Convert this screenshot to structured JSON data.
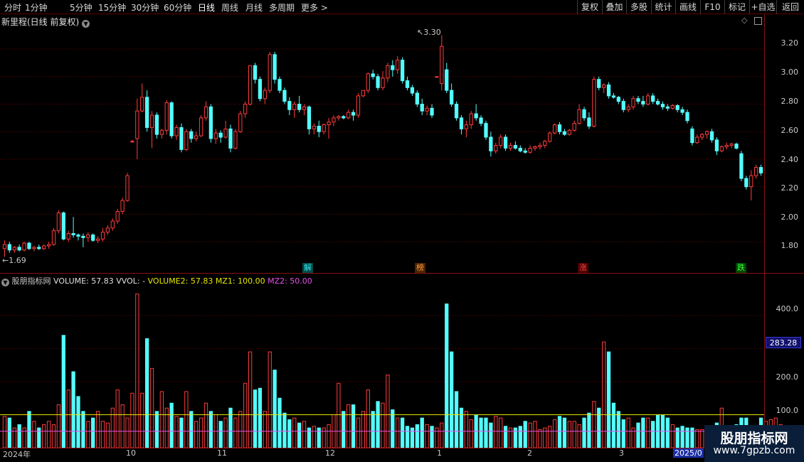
{
  "toolbar": {
    "periods": [
      "分时",
      "1分钟",
      "5分钟",
      "15分钟",
      "30分钟",
      "60分钟",
      "日线",
      "周线",
      "月线",
      "多周期",
      "更多 >"
    ],
    "active_period": "日线",
    "right_buttons": [
      "复权",
      "叠加",
      "多股",
      "统计",
      "画线",
      "F10",
      "标记",
      "+自选",
      "返回"
    ]
  },
  "price_panel": {
    "title": "新里程(日线 前复权)",
    "max_label": "3.30",
    "min_label": "1.69",
    "y_ticks": [
      "3.20",
      "3.00",
      "2.80",
      "2.60",
      "2.40",
      "2.20",
      "2.00",
      "1.80"
    ],
    "events": [
      {
        "label": "解",
        "color": "#35e8e8",
        "bg": "#004848"
      },
      {
        "label": "榜",
        "color": "#ff9944",
        "bg": "#4a2400"
      },
      {
        "label": "涨",
        "color": "#ff4040",
        "bg": "#480000"
      },
      {
        "label": "跌",
        "color": "#40ff40",
        "bg": "#004400"
      }
    ]
  },
  "volume_panel": {
    "indicator_name": "股朋指标网",
    "volume": "VOLUME: 57.83",
    "vvol": "VVOL: -",
    "volume2": "VOLUME2: 57.83",
    "mz1": "MZ1: 100.00",
    "mz2": "MZ2: 50.00",
    "y_ticks": [
      "400.0",
      "200.0",
      "100.0"
    ],
    "current_label": "283.28"
  },
  "x_axis": [
    "2024年",
    "10",
    "11",
    "12",
    "1",
    "2",
    "3",
    "2025/0"
  ],
  "watermark": {
    "line1": "股朋指标网",
    "line2": "www.7gpzb.com"
  },
  "colors": {
    "up": "#ff3c3c",
    "down": "#54ffff",
    "mz1": "#e8e800",
    "mz2": "#e84fe8",
    "grid": "#7a0000"
  },
  "chart_data": [
    {
      "type": "candlestick",
      "title": "新里程(日线 前复权)",
      "ylim": [
        1.62,
        3.35
      ],
      "annotations": {
        "high": 3.3,
        "low": 1.69
      },
      "ohlc": [
        [
          1.75,
          1.81,
          1.69,
          1.78
        ],
        [
          1.78,
          1.8,
          1.72,
          1.74
        ],
        [
          1.74,
          1.77,
          1.72,
          1.76
        ],
        [
          1.76,
          1.78,
          1.73,
          1.74
        ],
        [
          1.74,
          1.8,
          1.73,
          1.79
        ],
        [
          1.79,
          1.8,
          1.74,
          1.75
        ],
        [
          1.75,
          1.77,
          1.73,
          1.76
        ],
        [
          1.76,
          1.78,
          1.74,
          1.75
        ],
        [
          1.75,
          1.78,
          1.74,
          1.77
        ],
        [
          1.77,
          1.8,
          1.75,
          1.78
        ],
        [
          1.78,
          1.9,
          1.77,
          1.88
        ],
        [
          1.88,
          2.03,
          1.86,
          2.01
        ],
        [
          2.01,
          2.02,
          1.81,
          1.82
        ],
        [
          1.82,
          1.88,
          1.8,
          1.86
        ],
        [
          1.86,
          1.98,
          1.83,
          1.85
        ],
        [
          1.85,
          1.86,
          1.81,
          1.84
        ],
        [
          1.84,
          1.86,
          1.76,
          1.83
        ],
        [
          1.83,
          1.87,
          1.8,
          1.85
        ],
        [
          1.85,
          1.86,
          1.8,
          1.81
        ],
        [
          1.81,
          1.84,
          1.79,
          1.82
        ],
        [
          1.82,
          1.9,
          1.8,
          1.87
        ],
        [
          1.87,
          1.92,
          1.85,
          1.9
        ],
        [
          1.9,
          1.97,
          1.88,
          1.95
        ],
        [
          1.95,
          2.04,
          1.93,
          2.02
        ],
        [
          2.02,
          2.12,
          2.0,
          2.1
        ],
        [
          2.1,
          2.3,
          2.09,
          2.28
        ],
        [
          2.53,
          2.54,
          2.52,
          2.53
        ],
        [
          2.55,
          2.84,
          2.4,
          2.75
        ],
        [
          2.75,
          2.95,
          2.74,
          2.85
        ],
        [
          2.85,
          2.9,
          2.6,
          2.63
        ],
        [
          2.63,
          2.75,
          2.48,
          2.72
        ],
        [
          2.72,
          2.74,
          2.55,
          2.58
        ],
        [
          2.58,
          2.62,
          2.55,
          2.61
        ],
        [
          2.61,
          2.83,
          2.58,
          2.81
        ],
        [
          2.81,
          2.82,
          2.55,
          2.57
        ],
        [
          2.57,
          2.65,
          2.54,
          2.63
        ],
        [
          2.63,
          2.66,
          2.45,
          2.47
        ],
        [
          2.47,
          2.62,
          2.46,
          2.6
        ],
        [
          2.6,
          2.62,
          2.52,
          2.55
        ],
        [
          2.55,
          2.6,
          2.53,
          2.57
        ],
        [
          2.57,
          2.72,
          2.56,
          2.7
        ],
        [
          2.7,
          2.82,
          2.68,
          2.78
        ],
        [
          2.78,
          2.8,
          2.52,
          2.55
        ],
        [
          2.55,
          2.62,
          2.51,
          2.59
        ],
        [
          2.59,
          2.61,
          2.52,
          2.56
        ],
        [
          2.56,
          2.68,
          2.55,
          2.62
        ],
        [
          2.62,
          2.65,
          2.45,
          2.48
        ],
        [
          2.48,
          2.62,
          2.47,
          2.6
        ],
        [
          2.6,
          2.75,
          2.59,
          2.73
        ],
        [
          2.73,
          2.82,
          2.7,
          2.8
        ],
        [
          2.8,
          2.95,
          2.79,
          3.08
        ],
        [
          3.08,
          3.1,
          2.95,
          2.98
        ],
        [
          2.98,
          3.0,
          2.82,
          2.84
        ],
        [
          2.84,
          2.92,
          2.8,
          2.9
        ],
        [
          2.9,
          3.18,
          2.88,
          3.16
        ],
        [
          3.16,
          3.18,
          2.95,
          2.98
        ],
        [
          2.98,
          3.0,
          2.88,
          2.9
        ],
        [
          2.9,
          2.92,
          2.8,
          2.82
        ],
        [
          2.82,
          2.85,
          2.72,
          2.76
        ],
        [
          2.76,
          2.82,
          2.7,
          2.8
        ],
        [
          2.8,
          2.86,
          2.74,
          2.76
        ],
        [
          2.76,
          2.8,
          2.72,
          2.78
        ],
        [
          2.78,
          2.79,
          2.58,
          2.62
        ],
        [
          2.62,
          2.66,
          2.58,
          2.64
        ],
        [
          2.64,
          2.68,
          2.56,
          2.6
        ],
        [
          2.6,
          2.66,
          2.58,
          2.65
        ],
        [
          2.65,
          2.7,
          2.55,
          2.67
        ],
        [
          2.67,
          2.72,
          2.64,
          2.7
        ],
        [
          2.7,
          2.72,
          2.68,
          2.71
        ],
        [
          2.71,
          2.72,
          2.69,
          2.7
        ],
        [
          2.7,
          2.76,
          2.69,
          2.74
        ],
        [
          2.74,
          2.76,
          2.68,
          2.72
        ],
        [
          2.72,
          2.88,
          2.7,
          2.86
        ],
        [
          2.86,
          2.9,
          2.85,
          2.9
        ],
        [
          2.9,
          3.03,
          2.88,
          3.02
        ],
        [
          3.02,
          3.05,
          2.98,
          3.0
        ],
        [
          3.0,
          3.02,
          2.9,
          2.92
        ],
        [
          2.92,
          3.04,
          2.9,
          2.99
        ],
        [
          2.99,
          3.1,
          2.96,
          3.08
        ],
        [
          3.08,
          3.12,
          3.0,
          3.05
        ],
        [
          3.05,
          3.15,
          3.02,
          3.12
        ],
        [
          3.12,
          3.14,
          2.95,
          2.97
        ],
        [
          2.97,
          3.0,
          2.9,
          2.92
        ],
        [
          2.92,
          2.94,
          2.86,
          2.88
        ],
        [
          2.88,
          2.9,
          2.78,
          2.8
        ],
        [
          2.8,
          2.84,
          2.72,
          2.75
        ],
        [
          2.75,
          2.79,
          2.72,
          2.77
        ],
        [
          2.77,
          2.8,
          2.7,
          2.72
        ],
        [
          3.0,
          3.0,
          3.0,
          3.0
        ],
        [
          2.95,
          3.3,
          2.9,
          3.22
        ],
        [
          3.05,
          3.1,
          2.88,
          2.9
        ],
        [
          2.9,
          2.95,
          2.78,
          2.8
        ],
        [
          2.8,
          2.82,
          2.68,
          2.7
        ],
        [
          2.7,
          2.72,
          2.58,
          2.62
        ],
        [
          2.62,
          2.68,
          2.56,
          2.65
        ],
        [
          2.65,
          2.75,
          2.62,
          2.73
        ],
        [
          2.73,
          2.8,
          2.68,
          2.7
        ],
        [
          2.7,
          2.72,
          2.64,
          2.66
        ],
        [
          2.66,
          2.68,
          2.54,
          2.56
        ],
        [
          2.56,
          2.6,
          2.42,
          2.46
        ],
        [
          2.46,
          2.52,
          2.44,
          2.5
        ],
        [
          2.5,
          2.58,
          2.48,
          2.56
        ],
        [
          2.56,
          2.58,
          2.46,
          2.48
        ],
        [
          2.48,
          2.52,
          2.46,
          2.5
        ],
        [
          2.5,
          2.53,
          2.47,
          2.48
        ],
        [
          2.48,
          2.5,
          2.45,
          2.46
        ],
        [
          2.46,
          2.48,
          2.44,
          2.45
        ],
        [
          2.45,
          2.5,
          2.44,
          2.48
        ],
        [
          2.48,
          2.5,
          2.46,
          2.49
        ],
        [
          2.49,
          2.52,
          2.47,
          2.5
        ],
        [
          2.5,
          2.54,
          2.48,
          2.53
        ],
        [
          2.53,
          2.6,
          2.52,
          2.59
        ],
        [
          2.59,
          2.66,
          2.58,
          2.65
        ],
        [
          2.65,
          2.67,
          2.58,
          2.6
        ],
        [
          2.6,
          2.62,
          2.57,
          2.58
        ],
        [
          2.58,
          2.62,
          2.57,
          2.61
        ],
        [
          2.61,
          2.68,
          2.6,
          2.66
        ],
        [
          2.66,
          2.8,
          2.65,
          2.76
        ],
        [
          2.76,
          2.78,
          2.68,
          2.7
        ],
        [
          2.7,
          2.74,
          2.62,
          2.64
        ],
        [
          2.64,
          3.0,
          2.63,
          2.98
        ],
        [
          2.98,
          3.0,
          2.9,
          2.92
        ],
        [
          2.92,
          2.95,
          2.88,
          2.94
        ],
        [
          2.94,
          2.96,
          2.84,
          2.86
        ],
        [
          2.86,
          2.88,
          2.84,
          2.85
        ],
        [
          2.85,
          2.86,
          2.8,
          2.82
        ],
        [
          2.82,
          2.84,
          2.74,
          2.76
        ],
        [
          2.76,
          2.8,
          2.74,
          2.78
        ],
        [
          2.78,
          2.86,
          2.76,
          2.84
        ],
        [
          2.84,
          2.86,
          2.8,
          2.82
        ],
        [
          2.82,
          2.86,
          2.78,
          2.8
        ],
        [
          2.8,
          2.88,
          2.79,
          2.86
        ],
        [
          2.86,
          2.88,
          2.8,
          2.82
        ],
        [
          2.82,
          2.84,
          2.79,
          2.8
        ],
        [
          2.8,
          2.82,
          2.76,
          2.78
        ],
        [
          2.78,
          2.8,
          2.75,
          2.77
        ],
        [
          2.77,
          2.8,
          2.76,
          2.79
        ],
        [
          2.79,
          2.8,
          2.74,
          2.76
        ],
        [
          2.76,
          2.78,
          2.72,
          2.74
        ],
        [
          2.74,
          2.76,
          2.66,
          2.68
        ],
        [
          2.62,
          2.64,
          2.5,
          2.52
        ],
        [
          2.52,
          2.58,
          2.51,
          2.56
        ],
        [
          2.56,
          2.59,
          2.54,
          2.58
        ],
        [
          2.58,
          2.61,
          2.55,
          2.6
        ],
        [
          2.6,
          2.62,
          2.52,
          2.54
        ],
        [
          2.54,
          2.56,
          2.43,
          2.46
        ],
        [
          2.46,
          2.5,
          2.45,
          2.49
        ],
        [
          2.49,
          2.52,
          2.47,
          2.5
        ],
        [
          2.5,
          2.52,
          2.48,
          2.51
        ],
        [
          2.51,
          2.52,
          2.47,
          2.48
        ],
        [
          2.44,
          2.46,
          2.24,
          2.26
        ],
        [
          2.26,
          2.28,
          2.18,
          2.2
        ],
        [
          2.2,
          2.32,
          2.1,
          2.28
        ],
        [
          2.28,
          2.36,
          2.26,
          2.34
        ],
        [
          2.34,
          2.36,
          2.28,
          2.3
        ]
      ]
    },
    {
      "type": "bar",
      "title": "VOLUME",
      "ylim": [
        0,
        490
      ],
      "lines": {
        "MZ1": 100,
        "MZ2": 50
      },
      "volumes": [
        95,
        90,
        60,
        70,
        60,
        110,
        80,
        60,
        70,
        80,
        70,
        130,
        340,
        175,
        230,
        155,
        110,
        80,
        90,
        110,
        80,
        75,
        120,
        175,
        130,
        90,
        165,
        465,
        165,
        330,
        240,
        110,
        170,
        120,
        135,
        95,
        90,
        170,
        110,
        80,
        90,
        135,
        110,
        100,
        80,
        90,
        120,
        90,
        110,
        195,
        290,
        175,
        180,
        110,
        290,
        235,
        150,
        105,
        85,
        90,
        75,
        80,
        60,
        65,
        60,
        60,
        70,
        100,
        195,
        110,
        130,
        130,
        90,
        110,
        175,
        110,
        140,
        135,
        220,
        115,
        90,
        90,
        65,
        60,
        70,
        90,
        70,
        65,
        60,
        75,
        435,
        290,
        170,
        120,
        110,
        85,
        100,
        90,
        90,
        75,
        95,
        90,
        65,
        60,
        60,
        65,
        80,
        75,
        80,
        55,
        60,
        65,
        85,
        95,
        90,
        80,
        80,
        70,
        90,
        105,
        140,
        120,
        320,
        290,
        135,
        110,
        85,
        90,
        60,
        75,
        90,
        90,
        80,
        100,
        100,
        90,
        70,
        60,
        65,
        60,
        60,
        55,
        55,
        60,
        65,
        75,
        120,
        65,
        55,
        70,
        90,
        90,
        60,
        50,
        90,
        80,
        85,
        90,
        70,
        60
      ]
    }
  ]
}
